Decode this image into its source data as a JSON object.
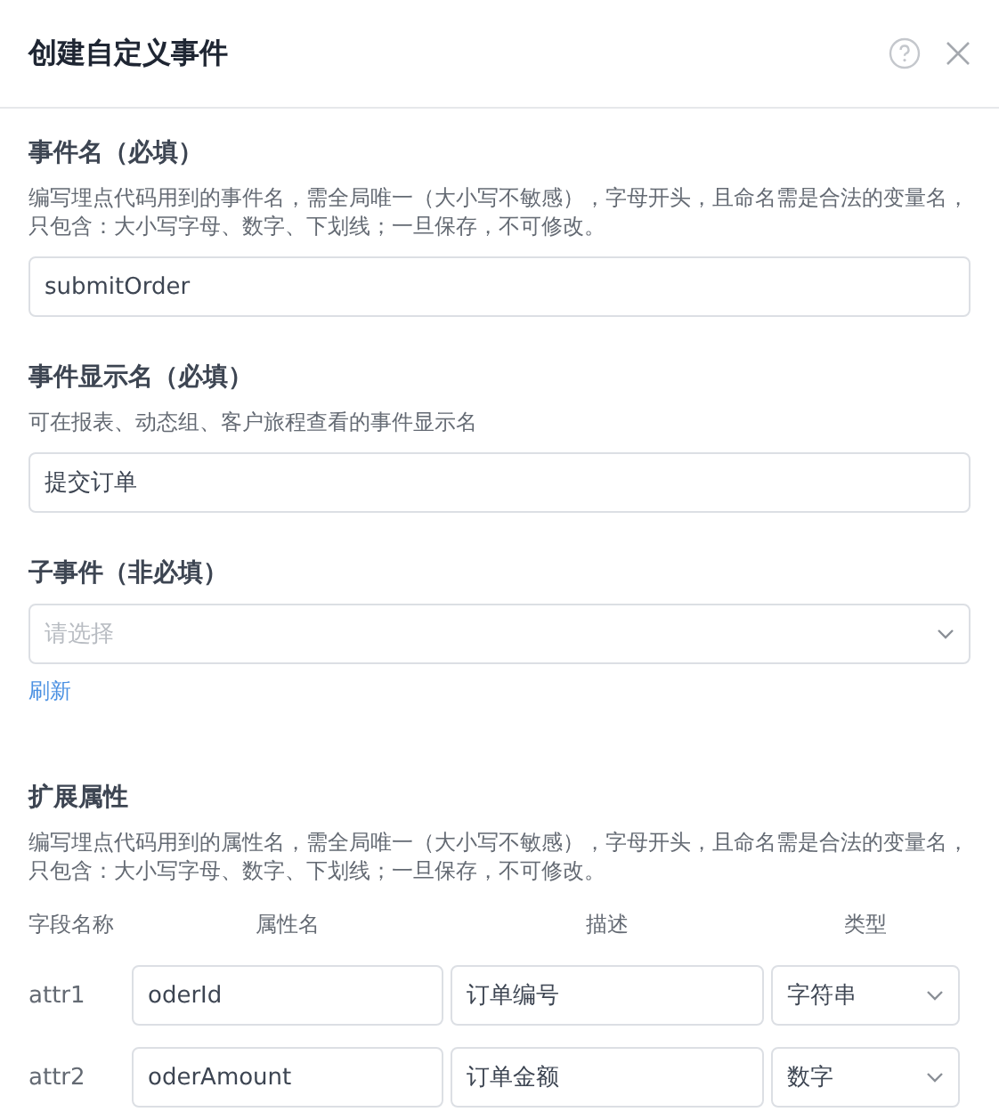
{
  "dialog": {
    "title": "创建自定义事件"
  },
  "sections": [
    {
      "kind": "input",
      "label": "事件名（必填）",
      "description": "编写埋点代码用到的事件名，需全局唯一（大小写不敏感），字母开头，且命名需是合法的变量名，只包含：大小写字母、数字、下划线；一旦保存，不可修改。",
      "value": "submitOrder"
    },
    {
      "kind": "input",
      "label": "事件显示名（必填）",
      "description": "可在报表、动态组、客户旅程查看的事件显示名",
      "value": "提交订单"
    },
    {
      "kind": "select",
      "label": "子事件（非必填）",
      "placeholder": "请选择",
      "link": "刷新"
    }
  ],
  "attributes": {
    "label": "扩展属性",
    "description": "编写埋点代码用到的属性名，需全局唯一（大小写不敏感），字母开头，且命名需是合法的变量名，只包含：大小写字母、数字、下划线；一旦保存，不可修改。",
    "columns": [
      "字段名称",
      "属性名",
      "描述",
      "类型"
    ],
    "rows": [
      {
        "field": "attr1",
        "name": "oderId",
        "description": "订单编号",
        "type": "字符串"
      },
      {
        "field": "attr2",
        "name": "oderAmount",
        "description": "订单金额",
        "type": "数字"
      }
    ]
  }
}
